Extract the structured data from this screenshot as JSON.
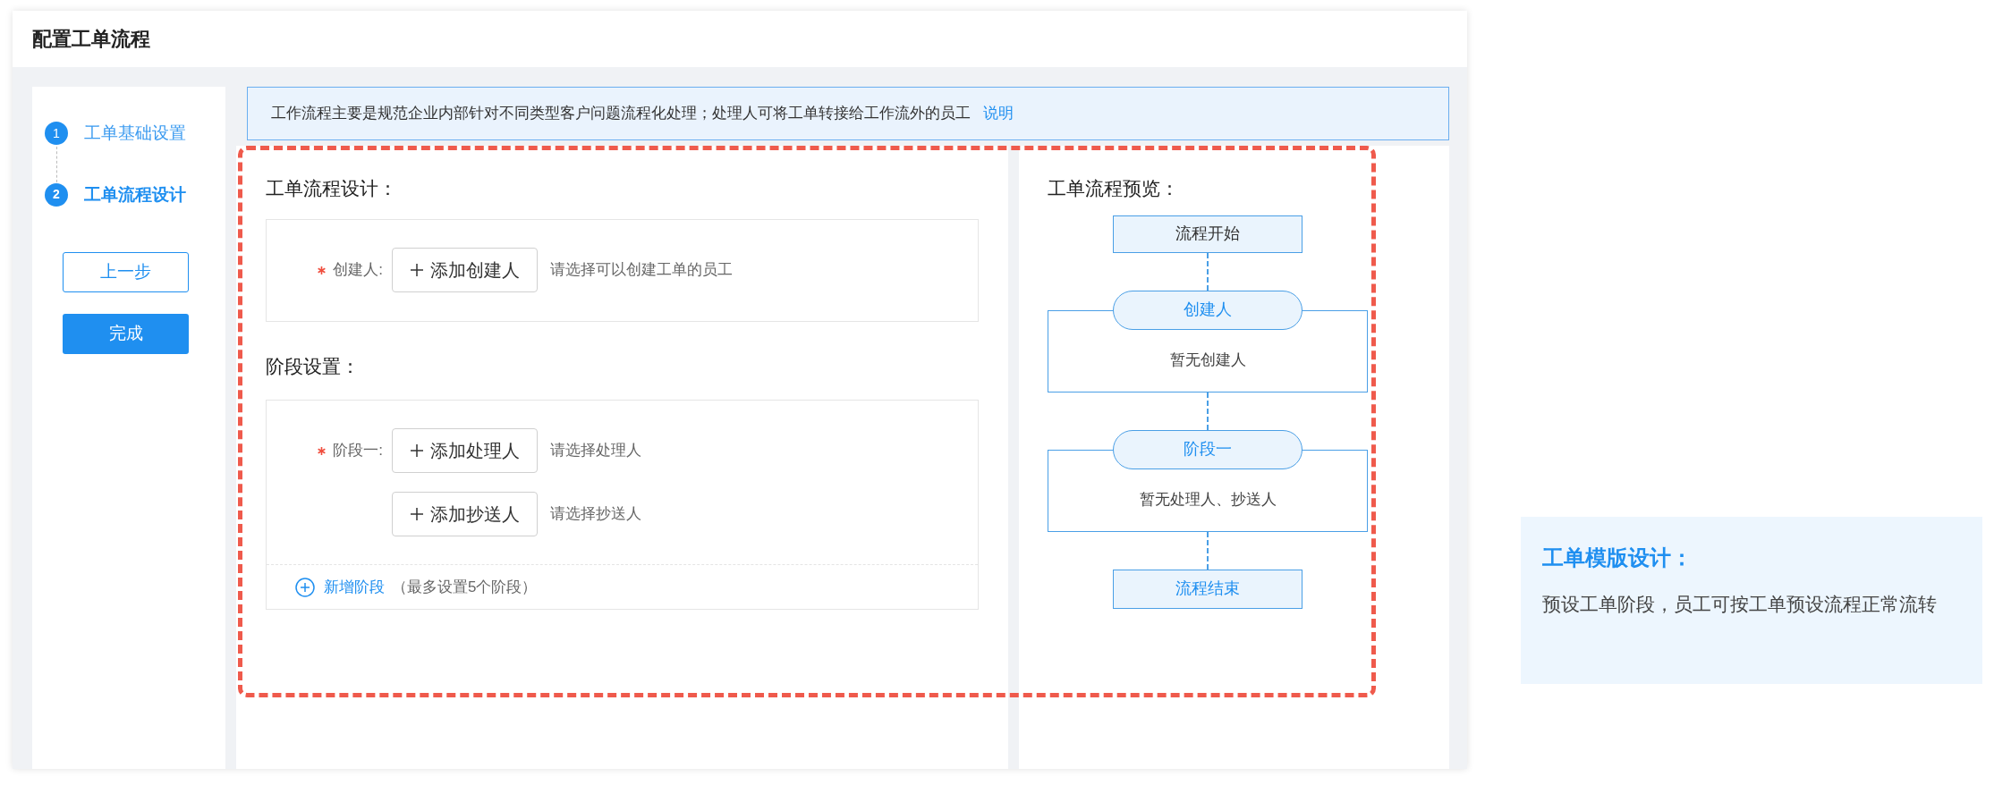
{
  "page_title": "配置工单流程",
  "steps": [
    {
      "number": "1",
      "label": "工单基础设置",
      "selected": false
    },
    {
      "number": "2",
      "label": "工单流程设计",
      "selected": true
    }
  ],
  "step_buttons": [
    {
      "label": "上一步",
      "kind": "outline"
    },
    {
      "label": "完成",
      "kind": "primary"
    }
  ],
  "notice": {
    "text": "工作流程主要是规范企业内部针对不同类型客户问题流程化处理；处理人可将工单转接给工作流外的员工",
    "link": "说明"
  },
  "design": {
    "title": "工单流程设计：",
    "creator": {
      "label": "创建人:",
      "button": "添加创建人",
      "hint": "请选择可以创建工单的员工"
    },
    "stage_title": "阶段设置：",
    "stages": [
      {
        "label": "阶段一:",
        "rows": [
          {
            "button": "添加处理人",
            "hint": "请选择处理人"
          },
          {
            "button": "添加抄送人",
            "hint": "请选择抄送人"
          }
        ]
      }
    ],
    "add_stage": {
      "link": "新增阶段",
      "note": "（最多设置5个阶段）"
    }
  },
  "preview": {
    "title": "工单流程预览：",
    "nodes": [
      {
        "kind": "terminal",
        "label": "流程开始"
      },
      {
        "kind": "group",
        "label": "创建人",
        "body": "暂无创建人"
      },
      {
        "kind": "group",
        "label": "阶段一",
        "body": "暂无处理人、抄送人"
      },
      {
        "kind": "end",
        "label": "流程结束"
      }
    ]
  },
  "callout": {
    "title": "工单模版设计：",
    "text": "预设工单阶段，员工可按工单预设流程正常流转"
  }
}
